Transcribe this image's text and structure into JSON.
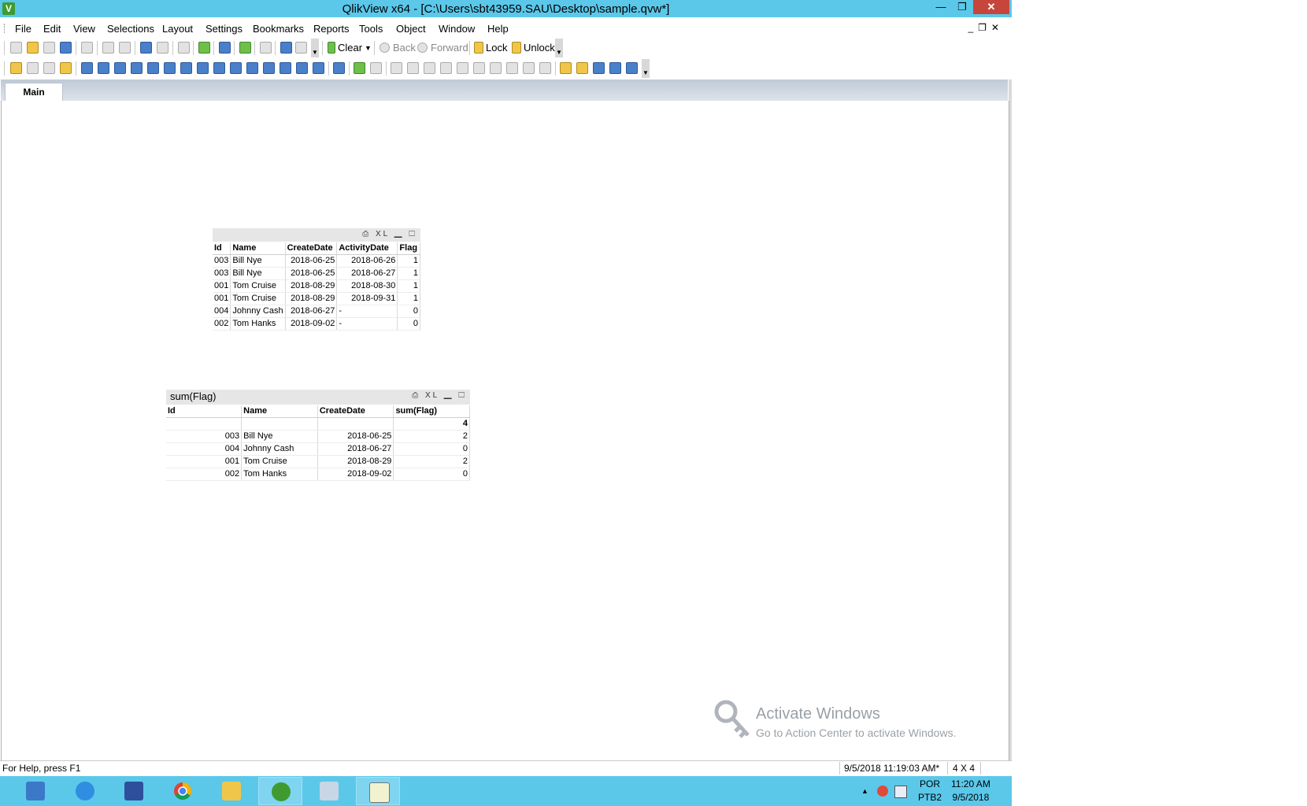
{
  "window": {
    "title": "QlikView x64 - [C:\\Users\\sbt43959.SAU\\Desktop\\sample.qvw*]",
    "app_icon": "V",
    "minimize": "—",
    "restore": "❐",
    "close": "✕"
  },
  "menu": [
    "File",
    "Edit",
    "View",
    "Selections",
    "Layout",
    "Settings",
    "Bookmarks",
    "Reports",
    "Tools",
    "Object",
    "Window",
    "Help"
  ],
  "toolbar": {
    "clear": "Clear",
    "back": "Back",
    "forward": "Forward",
    "lock": "Lock",
    "unlock": "Unlock"
  },
  "tabs": [
    {
      "label": "Main"
    }
  ],
  "table1": {
    "caption_icons": "⎙ XL ▁ ☐",
    "columns": [
      "Id",
      "Name",
      "CreateDate",
      "ActivityDate",
      "Flag"
    ],
    "rows": [
      [
        "003",
        "Bill Nye",
        "2018-06-25",
        "2018-06-26",
        "1"
      ],
      [
        "003",
        "Bill Nye",
        "2018-06-25",
        "2018-06-27",
        "1"
      ],
      [
        "001",
        "Tom Cruise",
        "2018-08-29",
        "2018-08-30",
        "1"
      ],
      [
        "001",
        "Tom Cruise",
        "2018-08-29",
        "2018-09-31",
        "1"
      ],
      [
        "004",
        "Johnny Cash",
        "2018-06-27",
        "-",
        "0"
      ],
      [
        "002",
        "Tom Hanks",
        "2018-09-02",
        "-",
        "0"
      ]
    ]
  },
  "table2": {
    "title": "sum(Flag)",
    "caption_icons": "⎙ XL ▁ ☐",
    "columns": [
      "Id",
      "Name",
      "CreateDate",
      "sum(Flag)"
    ],
    "total": "4",
    "rows": [
      [
        "003",
        "Bill Nye",
        "2018-06-25",
        "2"
      ],
      [
        "004",
        "Johnny Cash",
        "2018-06-27",
        "0"
      ],
      [
        "001",
        "Tom Cruise",
        "2018-08-29",
        "2"
      ],
      [
        "002",
        "Tom Hanks",
        "2018-09-02",
        "0"
      ]
    ]
  },
  "status": {
    "help": "For Help, press F1",
    "time": "9/5/2018 11:19:03 AM*",
    "dimensions": "4 X 4"
  },
  "watermark": {
    "title": "Activate Windows",
    "subtitle": "Go to Action Center to activate Windows."
  },
  "tray": {
    "lang1": "POR",
    "lang2": "PTB2",
    "time": "11:20 AM",
    "date": "9/5/2018"
  },
  "colors": {
    "titlebar": "#5bc8ea",
    "close_button": "#c7463c",
    "taskbar": "#5bc8ea"
  }
}
